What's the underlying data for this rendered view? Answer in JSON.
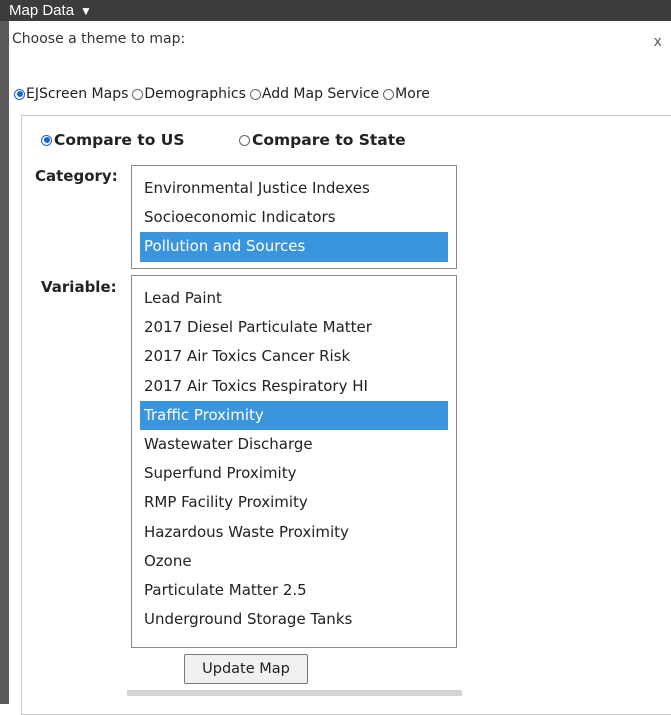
{
  "header": {
    "title": "Map Data",
    "arrow": "▼"
  },
  "theme": {
    "prompt": "Choose a theme to map:",
    "close": "x",
    "options": [
      {
        "label": "EJScreen Maps",
        "selected": true
      },
      {
        "label": "Demographics",
        "selected": false
      },
      {
        "label": "Add Map Service",
        "selected": false
      },
      {
        "label": "More",
        "selected": false
      }
    ]
  },
  "compare": {
    "options": [
      {
        "label": "Compare to US",
        "selected": true
      },
      {
        "label": "Compare to State",
        "selected": false
      }
    ]
  },
  "category": {
    "label": "Category:",
    "items": [
      "Environmental Justice Indexes",
      "Socioeconomic Indicators",
      "Pollution and Sources"
    ],
    "selected": "Pollution and Sources"
  },
  "variable": {
    "label": "Variable:",
    "items": [
      "Lead Paint",
      "2017 Diesel Particulate Matter",
      "2017 Air Toxics Cancer Risk",
      "2017 Air Toxics Respiratory HI",
      "Traffic Proximity",
      "Wastewater Discharge",
      "Superfund Proximity",
      "RMP Facility Proximity",
      "Hazardous Waste Proximity",
      "Ozone",
      "Particulate Matter 2.5",
      "Underground Storage Tanks"
    ],
    "selected": "Traffic Proximity"
  },
  "actions": {
    "update_label": "Update Map"
  },
  "colors": {
    "selection": "#3b95dd",
    "titlebar": "#3c3c3c",
    "radio_on": "#1a62d6"
  }
}
